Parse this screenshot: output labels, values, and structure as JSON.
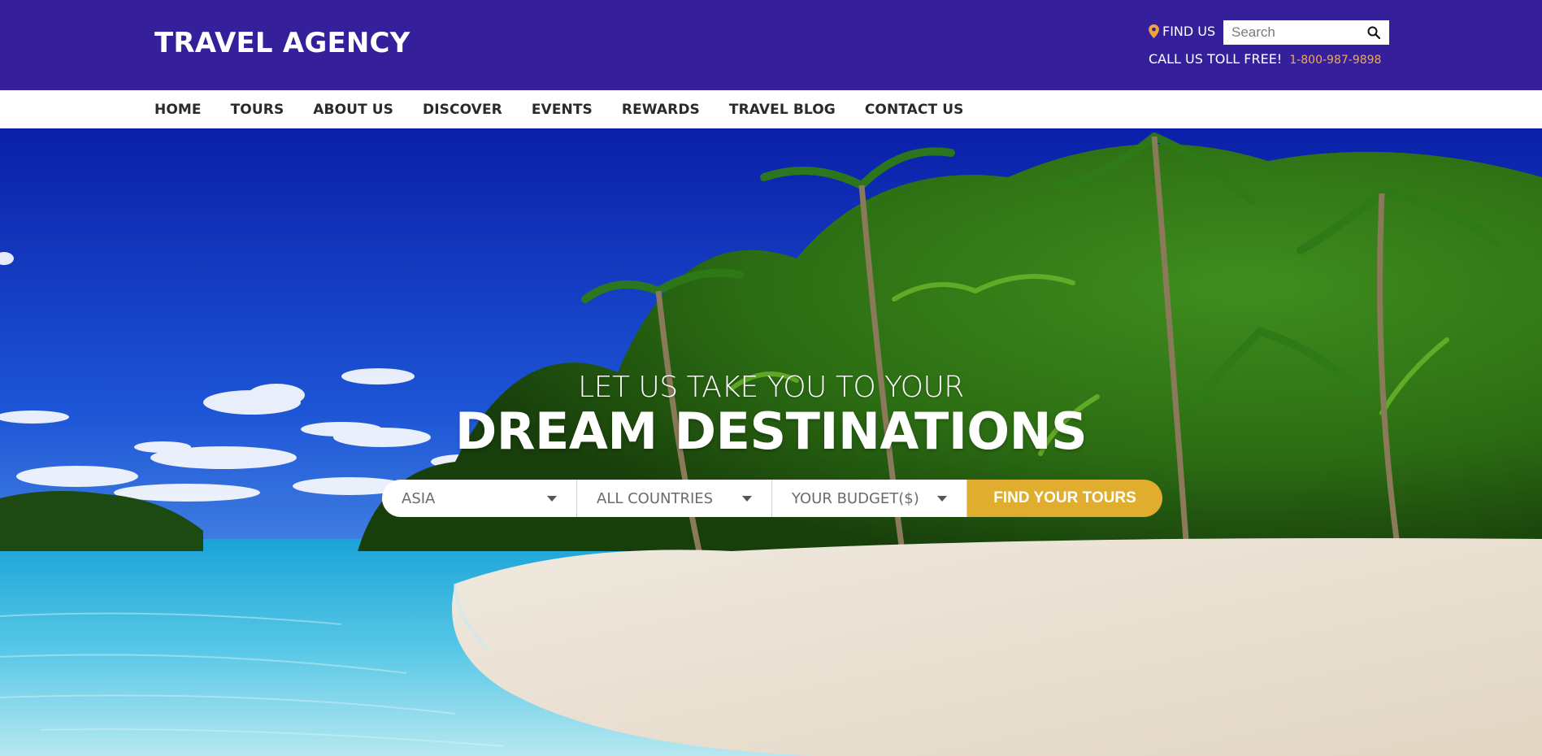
{
  "header": {
    "logo": "TRAVEL AGENCY",
    "find_us": "FIND US",
    "search": {
      "placeholder": "Search"
    },
    "toll_free_label": "CALL US TOLL FREE!",
    "phone": "1-800-987-9898"
  },
  "nav": {
    "items": [
      "HOME",
      "TOURS",
      "ABOUT US",
      "DISCOVER",
      "EVENTS",
      "REWARDS",
      "TRAVEL BLOG",
      "CONTACT US"
    ]
  },
  "hero": {
    "line1": "LET US TAKE YOU TO YOUR",
    "line2": "DREAM DESTINATIONS",
    "filters": {
      "region": "ASIA",
      "country": "ALL COUNTRIES",
      "budget": "YOUR BUDGET($)"
    },
    "submit": "FIND YOUR TOURS"
  },
  "colors": {
    "header_bg": "#361f9a",
    "accent": "#e0ad2e",
    "phone": "#f0a95a"
  },
  "icons": {
    "find_us": "map-pin-icon",
    "search": "search-icon",
    "dropdown": "caret-down-icon"
  }
}
